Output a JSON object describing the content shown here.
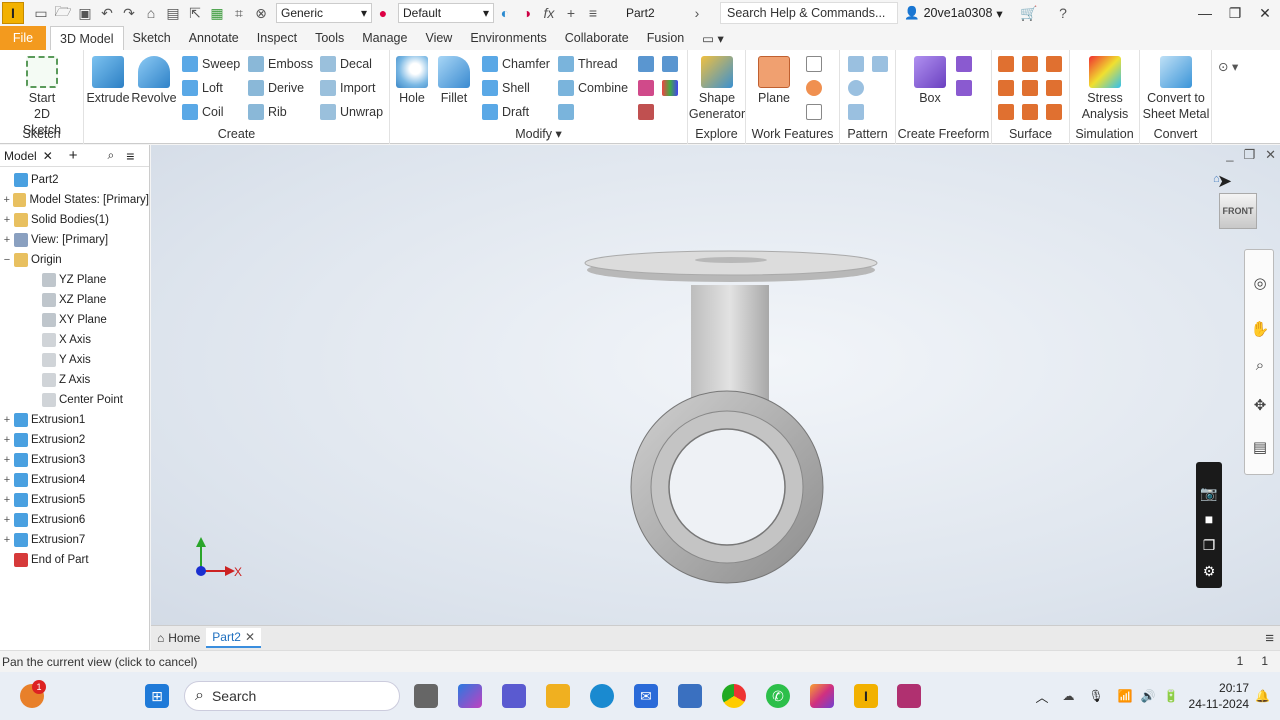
{
  "app": {
    "logo_letter": "I",
    "doc_title": "Part2"
  },
  "qat": {
    "appearance": "Generic",
    "material": "Default",
    "search_placeholder": "Search Help & Commands...",
    "user": "20ve1a0308"
  },
  "tabs": [
    "File",
    "3D Model",
    "Sketch",
    "Annotate",
    "Inspect",
    "Tools",
    "Manage",
    "View",
    "Environments",
    "Collaborate",
    "Fusion"
  ],
  "ribbon": {
    "sketch": {
      "label_line1": "Start",
      "label_line2": "2D Sketch",
      "group": "Sketch"
    },
    "create": {
      "group": "Create",
      "extrude": "Extrude",
      "revolve": "Revolve",
      "sweep": "Sweep",
      "loft": "Loft",
      "coil": "Coil",
      "emboss": "Emboss",
      "derive": "Derive",
      "rib": "Rib",
      "decal": "Decal",
      "import": "Import",
      "unwrap": "Unwrap"
    },
    "modify": {
      "group": "Modify",
      "hole": "Hole",
      "fillet": "Fillet",
      "chamfer": "Chamfer",
      "shell": "Shell",
      "draft": "Draft",
      "thread": "Thread",
      "combine": "Combine"
    },
    "explore": {
      "group": "Explore",
      "line1": "Shape",
      "line2": "Generator"
    },
    "work": {
      "group": "Work Features",
      "plane": "Plane"
    },
    "pattern": {
      "group": "Pattern"
    },
    "freeform": {
      "group": "Create Freeform",
      "box": "Box"
    },
    "surface": {
      "group": "Surface"
    },
    "simulation": {
      "group": "Simulation",
      "line1": "Stress",
      "line2": "Analysis"
    },
    "convert": {
      "group": "Convert",
      "line1": "Convert to",
      "line2": "Sheet Metal"
    }
  },
  "browser": {
    "tab": "Model",
    "nodes": [
      {
        "label": "Part2",
        "exp": "",
        "indent": 0,
        "icon": "#4aa0e0"
      },
      {
        "label": "Model States: [Primary]",
        "exp": "+",
        "indent": 0,
        "icon": "#e8c060"
      },
      {
        "label": "Solid Bodies(1)",
        "exp": "+",
        "indent": 0,
        "icon": "#e8c060"
      },
      {
        "label": "View: [Primary]",
        "exp": "+",
        "indent": 0,
        "icon": "#8aa0c0"
      },
      {
        "label": "Origin",
        "exp": "−",
        "indent": 0,
        "icon": "#e8c060"
      },
      {
        "label": "YZ Plane",
        "exp": "",
        "indent": 1,
        "icon": "#bfc6cc"
      },
      {
        "label": "XZ Plane",
        "exp": "",
        "indent": 1,
        "icon": "#bfc6cc"
      },
      {
        "label": "XY Plane",
        "exp": "",
        "indent": 1,
        "icon": "#bfc6cc"
      },
      {
        "label": "X Axis",
        "exp": "",
        "indent": 1,
        "icon": "#d0d4d8"
      },
      {
        "label": "Y Axis",
        "exp": "",
        "indent": 1,
        "icon": "#d0d4d8"
      },
      {
        "label": "Z Axis",
        "exp": "",
        "indent": 1,
        "icon": "#d0d4d8"
      },
      {
        "label": "Center Point",
        "exp": "",
        "indent": 1,
        "icon": "#d0d4d8"
      },
      {
        "label": "Extrusion1",
        "exp": "+",
        "indent": 0,
        "icon": "#4aa0e0"
      },
      {
        "label": "Extrusion2",
        "exp": "+",
        "indent": 0,
        "icon": "#4aa0e0"
      },
      {
        "label": "Extrusion3",
        "exp": "+",
        "indent": 0,
        "icon": "#4aa0e0"
      },
      {
        "label": "Extrusion4",
        "exp": "+",
        "indent": 0,
        "icon": "#4aa0e0"
      },
      {
        "label": "Extrusion5",
        "exp": "+",
        "indent": 0,
        "icon": "#4aa0e0"
      },
      {
        "label": "Extrusion6",
        "exp": "+",
        "indent": 0,
        "icon": "#4aa0e0"
      },
      {
        "label": "Extrusion7",
        "exp": "+",
        "indent": 0,
        "icon": "#4aa0e0"
      },
      {
        "label": "End of Part",
        "exp": "",
        "indent": 0,
        "icon": "#d63a3a"
      }
    ]
  },
  "viewcube": {
    "face": "FRONT"
  },
  "axes": {
    "x_label": "X"
  },
  "doctabs": {
    "home": "Home",
    "part": "Part2"
  },
  "status": {
    "message": "Pan the current view (click to cancel)",
    "num1": "1",
    "num2": "1"
  },
  "taskbar": {
    "search": "Search",
    "time": "20:17",
    "date": "24-11-2024",
    "badge": "1"
  }
}
